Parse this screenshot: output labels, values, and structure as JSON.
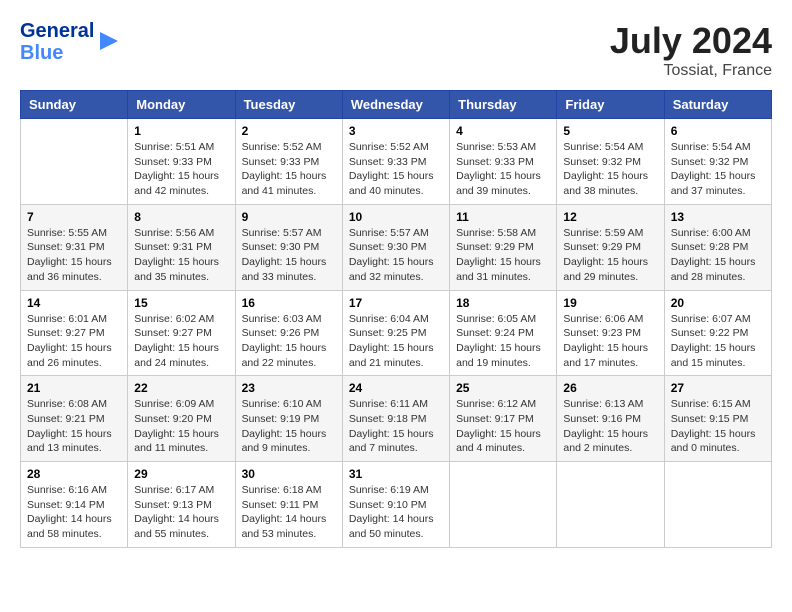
{
  "header": {
    "logo_line1": "General",
    "logo_line2": "Blue",
    "month_year": "July 2024",
    "location": "Tossiat, France"
  },
  "weekdays": [
    "Sunday",
    "Monday",
    "Tuesday",
    "Wednesday",
    "Thursday",
    "Friday",
    "Saturday"
  ],
  "weeks": [
    [
      {
        "day": "",
        "info": ""
      },
      {
        "day": "1",
        "info": "Sunrise: 5:51 AM\nSunset: 9:33 PM\nDaylight: 15 hours\nand 42 minutes."
      },
      {
        "day": "2",
        "info": "Sunrise: 5:52 AM\nSunset: 9:33 PM\nDaylight: 15 hours\nand 41 minutes."
      },
      {
        "day": "3",
        "info": "Sunrise: 5:52 AM\nSunset: 9:33 PM\nDaylight: 15 hours\nand 40 minutes."
      },
      {
        "day": "4",
        "info": "Sunrise: 5:53 AM\nSunset: 9:33 PM\nDaylight: 15 hours\nand 39 minutes."
      },
      {
        "day": "5",
        "info": "Sunrise: 5:54 AM\nSunset: 9:32 PM\nDaylight: 15 hours\nand 38 minutes."
      },
      {
        "day": "6",
        "info": "Sunrise: 5:54 AM\nSunset: 9:32 PM\nDaylight: 15 hours\nand 37 minutes."
      }
    ],
    [
      {
        "day": "7",
        "info": "Sunrise: 5:55 AM\nSunset: 9:31 PM\nDaylight: 15 hours\nand 36 minutes."
      },
      {
        "day": "8",
        "info": "Sunrise: 5:56 AM\nSunset: 9:31 PM\nDaylight: 15 hours\nand 35 minutes."
      },
      {
        "day": "9",
        "info": "Sunrise: 5:57 AM\nSunset: 9:30 PM\nDaylight: 15 hours\nand 33 minutes."
      },
      {
        "day": "10",
        "info": "Sunrise: 5:57 AM\nSunset: 9:30 PM\nDaylight: 15 hours\nand 32 minutes."
      },
      {
        "day": "11",
        "info": "Sunrise: 5:58 AM\nSunset: 9:29 PM\nDaylight: 15 hours\nand 31 minutes."
      },
      {
        "day": "12",
        "info": "Sunrise: 5:59 AM\nSunset: 9:29 PM\nDaylight: 15 hours\nand 29 minutes."
      },
      {
        "day": "13",
        "info": "Sunrise: 6:00 AM\nSunset: 9:28 PM\nDaylight: 15 hours\nand 28 minutes."
      }
    ],
    [
      {
        "day": "14",
        "info": "Sunrise: 6:01 AM\nSunset: 9:27 PM\nDaylight: 15 hours\nand 26 minutes."
      },
      {
        "day": "15",
        "info": "Sunrise: 6:02 AM\nSunset: 9:27 PM\nDaylight: 15 hours\nand 24 minutes."
      },
      {
        "day": "16",
        "info": "Sunrise: 6:03 AM\nSunset: 9:26 PM\nDaylight: 15 hours\nand 22 minutes."
      },
      {
        "day": "17",
        "info": "Sunrise: 6:04 AM\nSunset: 9:25 PM\nDaylight: 15 hours\nand 21 minutes."
      },
      {
        "day": "18",
        "info": "Sunrise: 6:05 AM\nSunset: 9:24 PM\nDaylight: 15 hours\nand 19 minutes."
      },
      {
        "day": "19",
        "info": "Sunrise: 6:06 AM\nSunset: 9:23 PM\nDaylight: 15 hours\nand 17 minutes."
      },
      {
        "day": "20",
        "info": "Sunrise: 6:07 AM\nSunset: 9:22 PM\nDaylight: 15 hours\nand 15 minutes."
      }
    ],
    [
      {
        "day": "21",
        "info": "Sunrise: 6:08 AM\nSunset: 9:21 PM\nDaylight: 15 hours\nand 13 minutes."
      },
      {
        "day": "22",
        "info": "Sunrise: 6:09 AM\nSunset: 9:20 PM\nDaylight: 15 hours\nand 11 minutes."
      },
      {
        "day": "23",
        "info": "Sunrise: 6:10 AM\nSunset: 9:19 PM\nDaylight: 15 hours\nand 9 minutes."
      },
      {
        "day": "24",
        "info": "Sunrise: 6:11 AM\nSunset: 9:18 PM\nDaylight: 15 hours\nand 7 minutes."
      },
      {
        "day": "25",
        "info": "Sunrise: 6:12 AM\nSunset: 9:17 PM\nDaylight: 15 hours\nand 4 minutes."
      },
      {
        "day": "26",
        "info": "Sunrise: 6:13 AM\nSunset: 9:16 PM\nDaylight: 15 hours\nand 2 minutes."
      },
      {
        "day": "27",
        "info": "Sunrise: 6:15 AM\nSunset: 9:15 PM\nDaylight: 15 hours\nand 0 minutes."
      }
    ],
    [
      {
        "day": "28",
        "info": "Sunrise: 6:16 AM\nSunset: 9:14 PM\nDaylight: 14 hours\nand 58 minutes."
      },
      {
        "day": "29",
        "info": "Sunrise: 6:17 AM\nSunset: 9:13 PM\nDaylight: 14 hours\nand 55 minutes."
      },
      {
        "day": "30",
        "info": "Sunrise: 6:18 AM\nSunset: 9:11 PM\nDaylight: 14 hours\nand 53 minutes."
      },
      {
        "day": "31",
        "info": "Sunrise: 6:19 AM\nSunset: 9:10 PM\nDaylight: 14 hours\nand 50 minutes."
      },
      {
        "day": "",
        "info": ""
      },
      {
        "day": "",
        "info": ""
      },
      {
        "day": "",
        "info": ""
      }
    ]
  ]
}
